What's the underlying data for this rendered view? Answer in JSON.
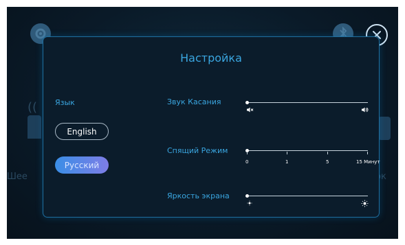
{
  "dialog": {
    "title": "Настройка"
  },
  "language": {
    "label": "Язык",
    "options": [
      "English",
      "Русский"
    ],
    "selected": "Русский"
  },
  "touch_sound": {
    "label": "Звук Касания",
    "level": 0,
    "min_icon": "volume-mute-icon",
    "max_icon": "volume-max-icon"
  },
  "sleep_mode": {
    "label": "Спящий Режим",
    "ticks": [
      "0",
      "1",
      "5",
      "15 Минут"
    ],
    "value": "0"
  },
  "brightness": {
    "label": "Яркость экрана",
    "level": 0,
    "min_icon": "brightness-low-icon",
    "max_icon": "brightness-high-icon"
  },
  "background": {
    "left_label": "Шее",
    "right_label": "ок"
  },
  "colors": {
    "accent": "#3aa6e0",
    "dialog_border": "#1f6fa0",
    "selected_gradient_start": "#3a8ee6",
    "selected_gradient_end": "#7e7de6"
  }
}
